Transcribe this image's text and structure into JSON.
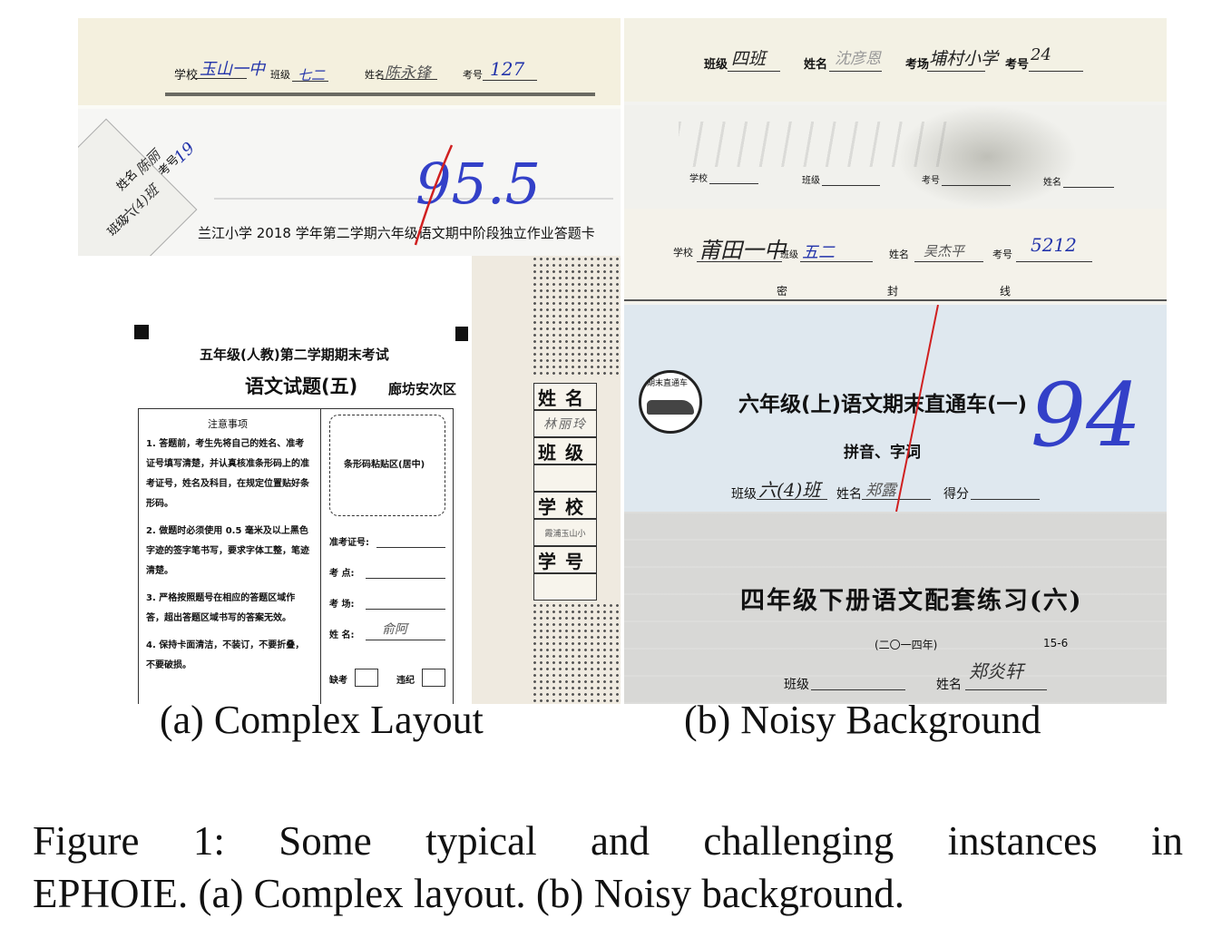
{
  "figure": {
    "subcaption_a": "(a) Complex Layout",
    "subcaption_b": "(b) Noisy Background",
    "caption_line1": "Figure 1: Some typical and challenging instances in",
    "caption_line2": "EPHOIE. (a) Complex layout. (b) Noisy background."
  },
  "panel_a": {
    "strip1": {
      "school_label": "学校",
      "school_value": "玉山一中",
      "class_label": "班级",
      "class_value": "七二",
      "name_label": "姓名",
      "name_value": "陈永锋",
      "exam_no_label": "考号",
      "exam_no_value": "127"
    },
    "strip2": {
      "name_label": "姓名",
      "name_value": "陈丽",
      "class_label": "班级",
      "class_value": "六(4)班",
      "exam_no_label": "考号",
      "exam_no_value": "19",
      "score": "95.5",
      "title": "兰江小学 2018 学年第二学期六年级语文期中阶段独立作业答题卡"
    },
    "strip3": {
      "title1": "五年级(人教)第二学期期末考试",
      "title2": "语文试题(五)",
      "district": "廊坊安次区",
      "notes_title": "注意事项",
      "note1": "1. 答题前，考生先将自己的姓名、准考证号填写清楚，并认真核准条形码上的准考证号，姓名及科目，在规定位置贴好条形码。",
      "note2": "2. 做题时必须使用 0.5 毫米及以上黑色字迹的签字笔书写，要求字体工整，笔迹清楚。",
      "note3": "3. 严格按照题号在相应的答题区域作答，超出答题区域书写的答案无效。",
      "note4": "4. 保持卡面清洁，不装订，不要折叠，不要破损。",
      "barcode_label": "条形码粘贴区(居中)",
      "ticket_label": "准考证号:",
      "room_label": "考    点:",
      "hall_label": "考    场:",
      "name_label": "姓    名:",
      "name_value": "俞阿",
      "absent_label": "缺考",
      "violation_label": "违纪",
      "side_name": "姓名",
      "side_name_value": "林丽玲",
      "side_class": "班级",
      "side_school": "学校",
      "side_school_value": "霞浦玉山小",
      "side_exam_no": "学号"
    }
  },
  "panel_b": {
    "strip1": {
      "class_label": "班级",
      "class_value": "四班",
      "name_label": "姓名",
      "name_value": "沈彦恩",
      "room_label": "考场",
      "room_value": "埔村小学",
      "exam_no_label": "考号",
      "exam_no_value": "24"
    },
    "strip2": {
      "school_label": "学校",
      "class_label": "班级",
      "exam_no_label": "考号",
      "name_label": "姓名"
    },
    "strip3": {
      "school_label": "学校",
      "school_value": "莆田一中",
      "class_label": "班级",
      "class_value": "五二",
      "name_label": "姓名",
      "name_value": "吴杰平",
      "exam_no_label": "考号",
      "exam_no_value": "5212",
      "seal1": "密",
      "seal2": "封",
      "seal3": "线"
    },
    "strip4": {
      "logo_text": "期末直通车",
      "title": "六年级(上)语文期末直通车(一)",
      "subtitle": "拼音、字词",
      "class_label": "班级",
      "class_value": "六(4)班",
      "name_label": "姓名",
      "name_value": "郑露",
      "score_label": "得分",
      "score_value": "94"
    },
    "strip5": {
      "title": "四年级下册语文配套练习(六)",
      "year": "(二〇一四年)",
      "page": "15-6",
      "class_label": "班级",
      "name_label": "姓名",
      "name_value": "郑炎轩"
    }
  }
}
